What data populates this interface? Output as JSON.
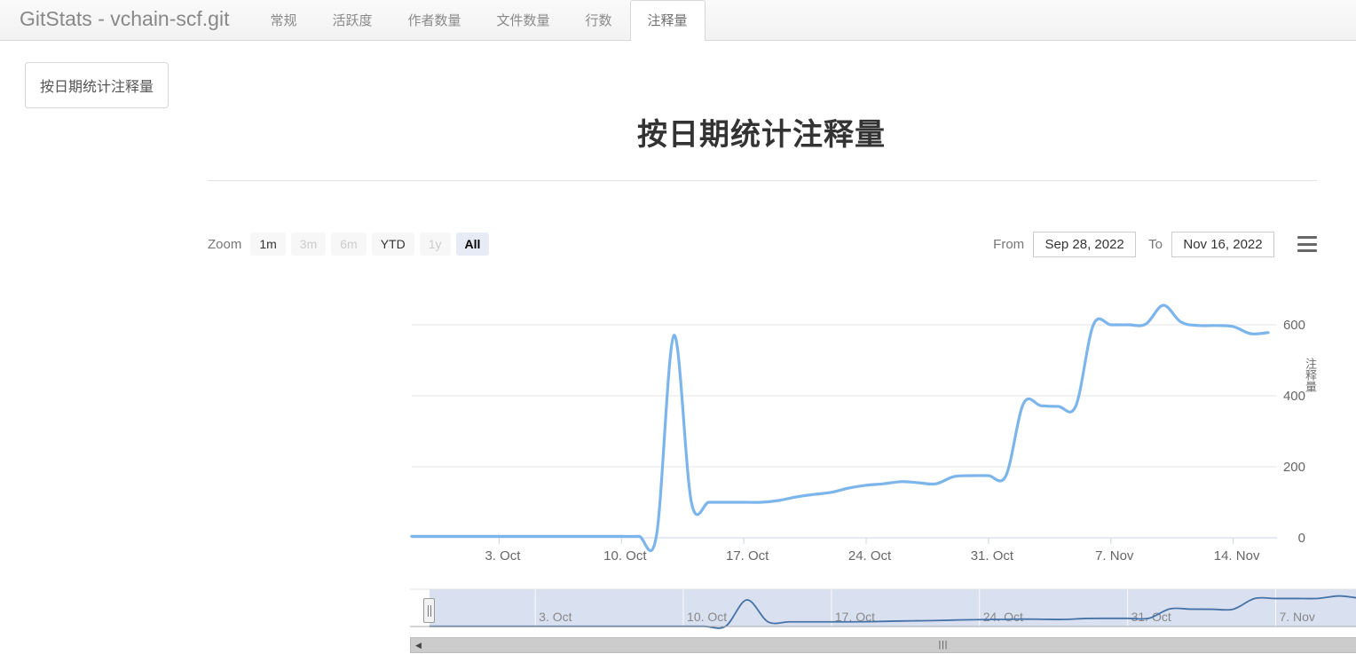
{
  "header": {
    "brand": "GitStats - vchain-scf.git",
    "tabs": [
      {
        "label": "常规",
        "active": false
      },
      {
        "label": "活跃度",
        "active": false
      },
      {
        "label": "作者数量",
        "active": false
      },
      {
        "label": "文件数量",
        "active": false
      },
      {
        "label": "行数",
        "active": false
      },
      {
        "label": "注释量",
        "active": true
      }
    ]
  },
  "sidebar": {
    "items": [
      {
        "label": "按日期统计注释量"
      }
    ]
  },
  "main": {
    "title": "按日期统计注释量"
  },
  "range_selector": {
    "zoom_label": "Zoom",
    "buttons": [
      {
        "label": "1m",
        "state": "normal"
      },
      {
        "label": "3m",
        "state": "disabled"
      },
      {
        "label": "6m",
        "state": "disabled"
      },
      {
        "label": "YTD",
        "state": "normal"
      },
      {
        "label": "1y",
        "state": "disabled"
      },
      {
        "label": "All",
        "state": "selected"
      }
    ],
    "from_label": "From",
    "from_value": "Sep 28, 2022",
    "to_label": "To",
    "to_value": "Nov 16, 2022",
    "menu_icon": "hamburger-icon"
  },
  "scrollbar": {
    "left_arrow": "◀",
    "right_arrow": "▶",
    "grip": "|||"
  },
  "chart_data": {
    "type": "line",
    "title": "按日期统计注释量",
    "xlabel": "",
    "ylabel": "注释量",
    "ylim": [
      0,
      700
    ],
    "yticks": [
      0,
      200,
      400,
      600
    ],
    "xticks": [
      "3. Oct",
      "10. Oct",
      "17. Oct",
      "24. Oct",
      "31. Oct",
      "7. Nov",
      "14. Nov"
    ],
    "x_range": [
      "Sep 28, 2022",
      "Nov 16, 2022"
    ],
    "grid": true,
    "legend": "none",
    "line_color": "#7cb5ec",
    "navigator_line_color": "#4572a7",
    "navigator_fill": "#ccd6eb",
    "series": [
      {
        "name": "注释量",
        "x": [
          "Sep 28",
          "Sep 29",
          "Sep 30",
          "Oct 1",
          "Oct 2",
          "Oct 3",
          "Oct 4",
          "Oct 5",
          "Oct 6",
          "Oct 7",
          "Oct 8",
          "Oct 9",
          "Oct 10",
          "Oct 11",
          "Oct 12",
          "Oct 13",
          "Oct 14",
          "Oct 15",
          "Oct 16",
          "Oct 17",
          "Oct 18",
          "Oct 19",
          "Oct 20",
          "Oct 21",
          "Oct 22",
          "Oct 23",
          "Oct 24",
          "Oct 25",
          "Oct 26",
          "Oct 27",
          "Oct 28",
          "Oct 29",
          "Oct 30",
          "Oct 31",
          "Nov 1",
          "Nov 2",
          "Nov 3",
          "Nov 4",
          "Nov 5",
          "Nov 6",
          "Nov 7",
          "Nov 8",
          "Nov 9",
          "Nov 10",
          "Nov 11",
          "Nov 12",
          "Nov 13",
          "Nov 14",
          "Nov 15",
          "Nov 16"
        ],
        "values": [
          4,
          4,
          4,
          4,
          4,
          4,
          4,
          4,
          4,
          4,
          4,
          4,
          4,
          4,
          6,
          570,
          100,
          100,
          100,
          100,
          100,
          105,
          115,
          122,
          128,
          140,
          148,
          152,
          158,
          155,
          152,
          172,
          175,
          175,
          175,
          378,
          372,
          370,
          372,
          600,
          600,
          600,
          602,
          655,
          608,
          598,
          598,
          595,
          575,
          578
        ]
      }
    ]
  }
}
